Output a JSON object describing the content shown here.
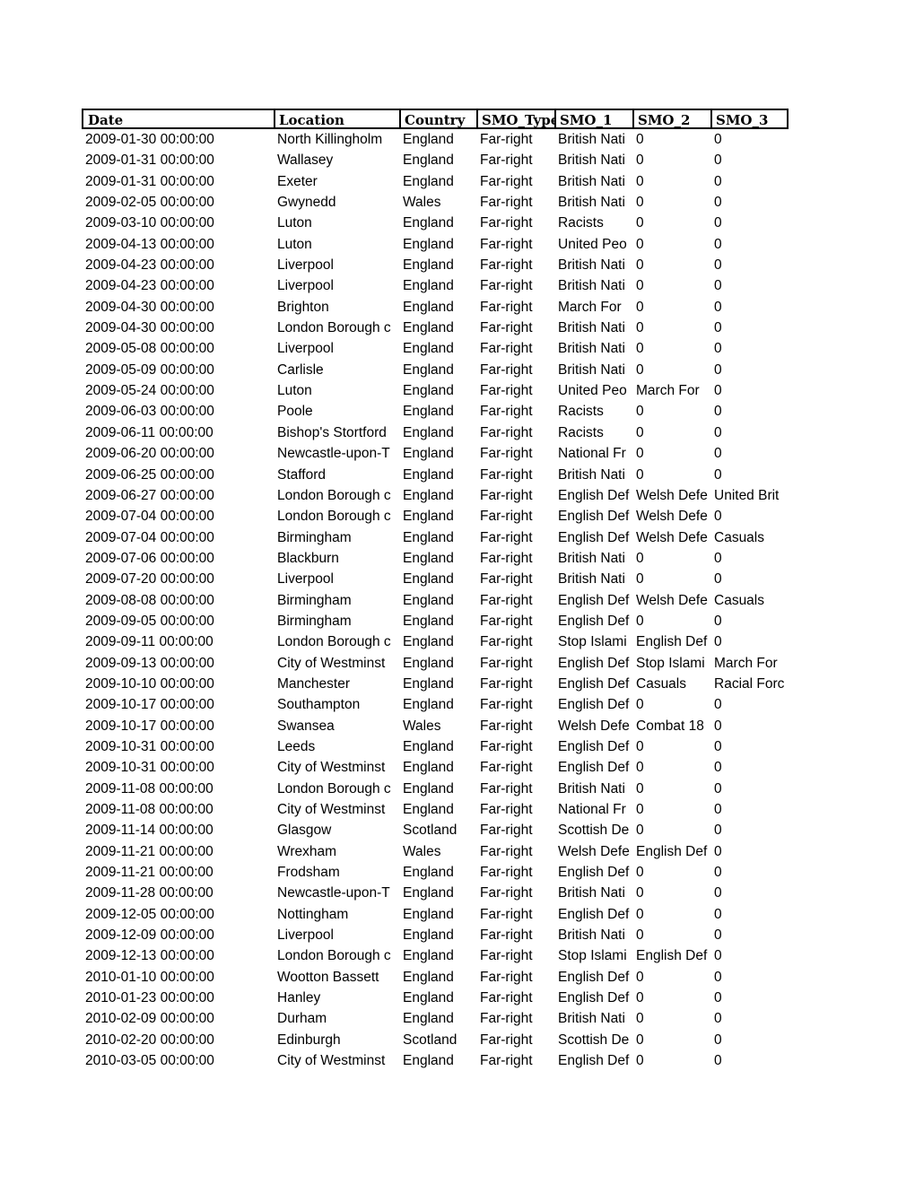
{
  "headers": [
    "Date",
    "Location",
    "Country",
    "SMO_Type",
    "SMO_1",
    "SMO_2",
    "SMO_3"
  ],
  "rows": [
    [
      "2009-01-30 00:00:00",
      "North Killingholm",
      "England",
      "Far-right",
      "British Nati",
      "0",
      "0"
    ],
    [
      "2009-01-31 00:00:00",
      "Wallasey",
      "England",
      "Far-right",
      "British Nati",
      "0",
      "0"
    ],
    [
      "2009-01-31 00:00:00",
      "Exeter",
      "England",
      "Far-right",
      "British Nati",
      "0",
      "0"
    ],
    [
      "2009-02-05 00:00:00",
      "Gwynedd",
      "Wales",
      "Far-right",
      "British Nati",
      "0",
      "0"
    ],
    [
      "2009-03-10 00:00:00",
      "Luton",
      "England",
      "Far-right",
      "Racists",
      "0",
      "0"
    ],
    [
      "2009-04-13 00:00:00",
      "Luton",
      "England",
      "Far-right",
      "United Peo",
      "0",
      "0"
    ],
    [
      "2009-04-23 00:00:00",
      "Liverpool",
      "England",
      "Far-right",
      "British Nati",
      "0",
      "0"
    ],
    [
      "2009-04-23 00:00:00",
      "Liverpool",
      "England",
      "Far-right",
      "British Nati",
      "0",
      "0"
    ],
    [
      "2009-04-30 00:00:00",
      "Brighton",
      "England",
      "Far-right",
      "March For",
      "0",
      "0"
    ],
    [
      "2009-04-30 00:00:00",
      "London Borough c",
      "England",
      "Far-right",
      "British Nati",
      "0",
      "0"
    ],
    [
      "2009-05-08 00:00:00",
      "Liverpool",
      "England",
      "Far-right",
      "British Nati",
      "0",
      "0"
    ],
    [
      "2009-05-09 00:00:00",
      "Carlisle",
      "England",
      "Far-right",
      "British Nati",
      "0",
      "0"
    ],
    [
      "2009-05-24 00:00:00",
      "Luton",
      "England",
      "Far-right",
      "United Peo",
      "March For",
      "0"
    ],
    [
      "2009-06-03 00:00:00",
      "Poole",
      "England",
      "Far-right",
      "Racists",
      "0",
      "0"
    ],
    [
      "2009-06-11 00:00:00",
      "Bishop's Stortford",
      "England",
      "Far-right",
      "Racists",
      "0",
      "0"
    ],
    [
      "2009-06-20 00:00:00",
      "Newcastle-upon-T",
      "England",
      "Far-right",
      "National Fr",
      "0",
      "0"
    ],
    [
      "2009-06-25 00:00:00",
      "Stafford",
      "England",
      "Far-right",
      "British Nati",
      "0",
      "0"
    ],
    [
      "2009-06-27 00:00:00",
      "London Borough c",
      "England",
      "Far-right",
      "English Def",
      "Welsh Defe",
      "United Brit"
    ],
    [
      "2009-07-04 00:00:00",
      "London Borough c",
      "England",
      "Far-right",
      "English Def",
      "Welsh Defe",
      "0"
    ],
    [
      "2009-07-04 00:00:00",
      "Birmingham",
      "England",
      "Far-right",
      "English Def",
      "Welsh Defe",
      "Casuals"
    ],
    [
      "2009-07-06 00:00:00",
      "Blackburn",
      "England",
      "Far-right",
      "British Nati",
      "0",
      "0"
    ],
    [
      "2009-07-20 00:00:00",
      "Liverpool",
      "England",
      "Far-right",
      "British Nati",
      "0",
      "0"
    ],
    [
      "2009-08-08 00:00:00",
      "Birmingham",
      "England",
      "Far-right",
      "English Def",
      "Welsh Defe",
      "Casuals"
    ],
    [
      "2009-09-05 00:00:00",
      "Birmingham",
      "England",
      "Far-right",
      "English Def",
      "0",
      "0"
    ],
    [
      "2009-09-11 00:00:00",
      "London Borough c",
      "England",
      "Far-right",
      "Stop Islami",
      "English Def",
      "0"
    ],
    [
      "2009-09-13 00:00:00",
      "City of Westminst",
      "England",
      "Far-right",
      "English Def",
      "Stop Islami",
      "March For"
    ],
    [
      "2009-10-10 00:00:00",
      "Manchester",
      "England",
      "Far-right",
      "English Def",
      "Casuals",
      "Racial Forc"
    ],
    [
      "2009-10-17 00:00:00",
      "Southampton",
      "England",
      "Far-right",
      "English Def",
      "0",
      "0"
    ],
    [
      "2009-10-17 00:00:00",
      "Swansea",
      "Wales",
      "Far-right",
      "Welsh Defe",
      "Combat 18",
      "0"
    ],
    [
      "2009-10-31 00:00:00",
      "Leeds",
      "England",
      "Far-right",
      "English Def",
      "0",
      "0"
    ],
    [
      "2009-10-31 00:00:00",
      "City of Westminst",
      "England",
      "Far-right",
      "English Def",
      "0",
      "0"
    ],
    [
      "2009-11-08 00:00:00",
      "London Borough c",
      "England",
      "Far-right",
      "British Nati",
      "0",
      "0"
    ],
    [
      "2009-11-08 00:00:00",
      "City of Westminst",
      "England",
      "Far-right",
      "National Fr",
      "0",
      "0"
    ],
    [
      "2009-11-14 00:00:00",
      "Glasgow",
      "Scotland",
      "Far-right",
      "Scottish De",
      "0",
      "0"
    ],
    [
      "2009-11-21 00:00:00",
      "Wrexham",
      "Wales",
      "Far-right",
      "Welsh Defe",
      "English Def",
      "0"
    ],
    [
      "2009-11-21 00:00:00",
      "Frodsham",
      "England",
      "Far-right",
      "English Def",
      "0",
      "0"
    ],
    [
      "2009-11-28 00:00:00",
      "Newcastle-upon-T",
      "England",
      "Far-right",
      "British Nati",
      "0",
      "0"
    ],
    [
      "2009-12-05 00:00:00",
      "Nottingham",
      "England",
      "Far-right",
      "English Def",
      "0",
      "0"
    ],
    [
      "2009-12-09 00:00:00",
      "Liverpool",
      "England",
      "Far-right",
      "British Nati",
      "0",
      "0"
    ],
    [
      "2009-12-13 00:00:00",
      "London Borough c",
      "England",
      "Far-right",
      "Stop Islami",
      "English Def",
      "0"
    ],
    [
      "2010-01-10 00:00:00",
      "Wootton Bassett",
      "England",
      "Far-right",
      "English Def",
      "0",
      "0"
    ],
    [
      "2010-01-23 00:00:00",
      "Hanley",
      "England",
      "Far-right",
      "English Def",
      "0",
      "0"
    ],
    [
      "2010-02-09 00:00:00",
      "Durham",
      "England",
      "Far-right",
      "British Nati",
      "0",
      "0"
    ],
    [
      "2010-02-20 00:00:00",
      "Edinburgh",
      "Scotland",
      "Far-right",
      "Scottish De",
      "0",
      "0"
    ],
    [
      "2010-03-05 00:00:00",
      "City of Westminst",
      "England",
      "Far-right",
      "English Def",
      "0",
      "0"
    ]
  ]
}
